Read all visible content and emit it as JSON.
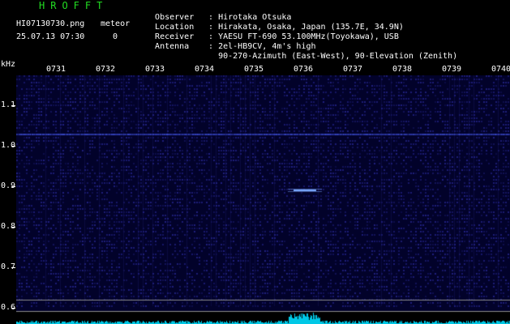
{
  "header": {
    "app_title": "HROFFT",
    "filename": "HI07130730.png",
    "meteor_label": "meteor",
    "datetime": "25.07.13 07:30",
    "meteor_count": "0"
  },
  "station_info": [
    {
      "key": "Observer",
      "value": "Hirotaka Otsuka"
    },
    {
      "key": "Location",
      "value": "Hirakata, Osaka, Japan (135.7E, 34.9N)"
    },
    {
      "key": "Receiver",
      "value": "YAESU FT-690 53.100MHz(Toyokawa), USB"
    },
    {
      "key": "Antenna",
      "value": "2el-HB9CV, 4m's high"
    },
    {
      "key": "",
      "value": "90-270-Azimuth (East-West), 90-Elevation (Zenith)"
    }
  ],
  "spectrogram": {
    "y_unit": "kHz",
    "x_ticks": [
      "0731",
      "0732",
      "0733",
      "0734",
      "0735",
      "0736",
      "0737",
      "0738",
      "0739",
      "0740"
    ],
    "y_ticks": [
      "1.1",
      "1.0",
      "0.9",
      "0.8",
      "0.7",
      "0.6"
    ],
    "colors": {
      "background": "#02022a",
      "noise": "#1e1e78",
      "carrier": "#3848c8",
      "echo": "#7aa8ff",
      "reference_line": "#8a8a8a",
      "level_meter": "#00c8e6"
    }
  }
}
